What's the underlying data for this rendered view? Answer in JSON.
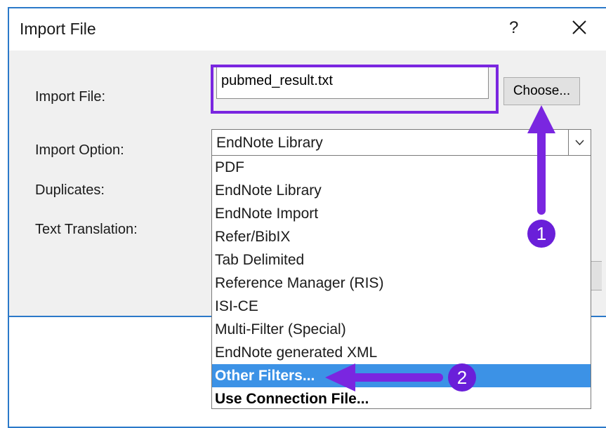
{
  "window": {
    "title": "Import File",
    "help_label": "?"
  },
  "form": {
    "import_file_label": "Import File:",
    "import_file_value": "pubmed_result.txt",
    "choose_label": "Choose...",
    "import_option_label": "Import Option:",
    "import_option_value": "EndNote Library",
    "duplicates_label": "Duplicates:",
    "text_translation_label": "Text Translation:"
  },
  "dropdown": {
    "options": [
      "PDF",
      "EndNote Library",
      "EndNote Import",
      "Refer/BibIX",
      "Tab Delimited",
      "Reference Manager (RIS)",
      "ISI-CE",
      "Multi-Filter (Special)",
      "EndNote generated XML",
      "Other Filters...",
      "Use Connection File..."
    ],
    "highlighted": "Other Filters..."
  },
  "annotations": {
    "step1": "1",
    "step2": "2",
    "accent_color": "#7a26e0",
    "selection_color": "#3c92e6"
  }
}
